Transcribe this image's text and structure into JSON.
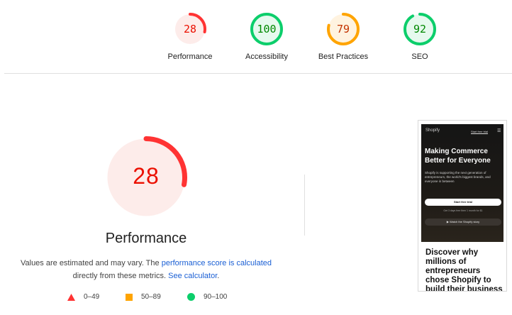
{
  "colors": {
    "fail": "#ff3333",
    "average": "#ffa400",
    "pass": "#0cce6b",
    "fail_bg": "#fdecea",
    "average_bg": "#fff3e0",
    "pass_bg": "#e6f9ee",
    "link": "#1a5fd4"
  },
  "categories": [
    {
      "label": "Performance",
      "score": "28",
      "value": 28,
      "status": "fail"
    },
    {
      "label": "Accessibility",
      "score": "100",
      "value": 100,
      "status": "pass"
    },
    {
      "label": "Best Practices",
      "score": "79",
      "value": 79,
      "status": "average"
    },
    {
      "label": "SEO",
      "score": "92",
      "value": 92,
      "status": "pass"
    }
  ],
  "main": {
    "score": "28",
    "value": 28,
    "title": "Performance",
    "desc_prefix": "Values are estimated and may vary. The ",
    "desc_link1": "performance score is calculated",
    "desc_middle": " directly from these metrics. ",
    "desc_link2": "See calculator",
    "desc_suffix": "."
  },
  "legend": [
    {
      "range": "0–49",
      "shape": "triangle-icon",
      "status": "fail"
    },
    {
      "range": "50–89",
      "shape": "square-icon",
      "status": "average"
    },
    {
      "range": "90–100",
      "shape": "circle-icon",
      "status": "pass"
    }
  ],
  "thumbnail": {
    "logo": "Shopify",
    "top_button": "Start free trial",
    "menu_icon": "hamburger-icon",
    "headline": "Making Commerce Better for Everyone",
    "subtext": "Shopify is supporting the next generation of entrepreneurs, the world's biggest brands, and everyone in between",
    "cta": "Start free trial",
    "note": "Get 3 days free then 1 month for $1",
    "watch": "Watch the Shopify story",
    "headline2": "Discover why millions of entrepreneurs chose Shopify to build their business"
  }
}
